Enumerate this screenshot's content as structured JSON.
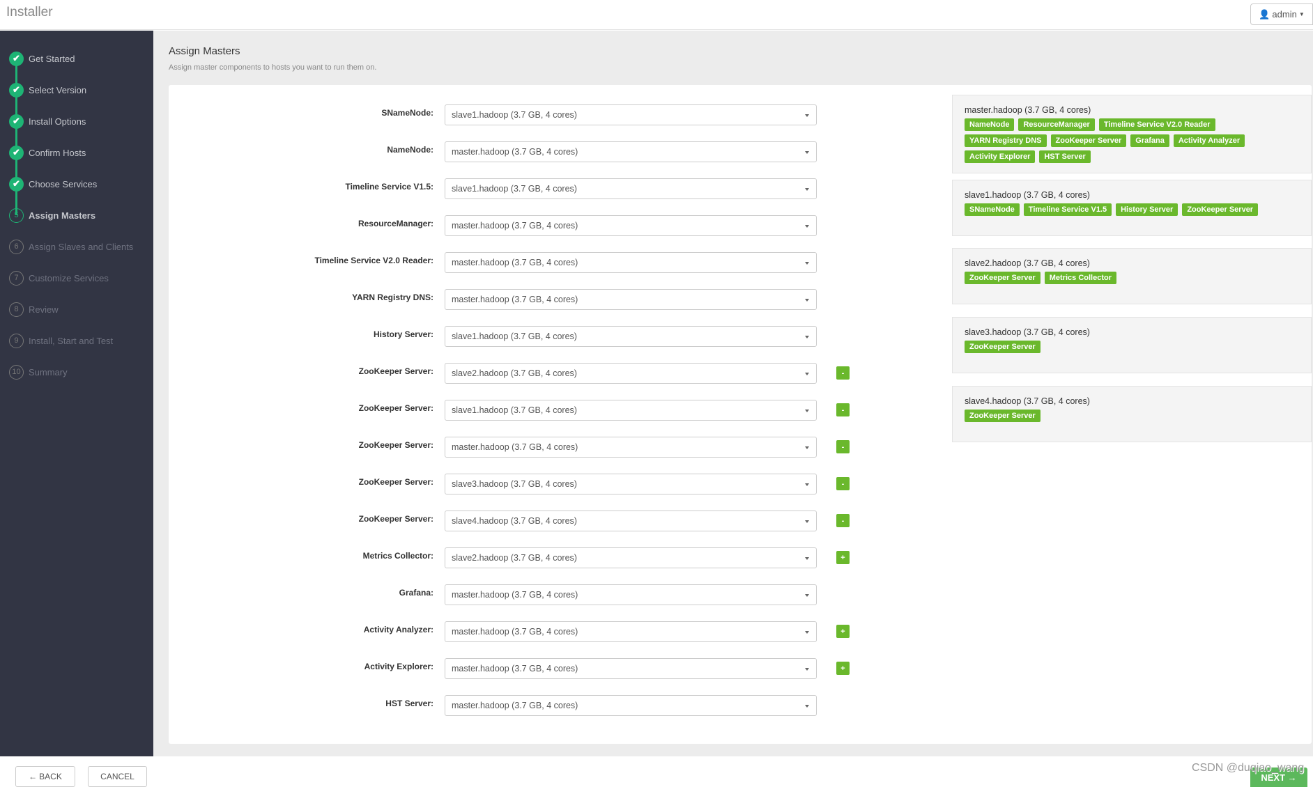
{
  "header": {
    "logo": "Installer",
    "user": "admin"
  },
  "sidebar": {
    "steps": [
      {
        "num": "1",
        "label": "Get Started",
        "state": "done"
      },
      {
        "num": "2",
        "label": "Select Version",
        "state": "done"
      },
      {
        "num": "3",
        "label": "Install Options",
        "state": "done"
      },
      {
        "num": "4",
        "label": "Confirm Hosts",
        "state": "done"
      },
      {
        "num": "5",
        "label": "Choose Services",
        "state": "done"
      },
      {
        "num": "5",
        "label": "Assign Masters",
        "state": "current"
      },
      {
        "num": "6",
        "label": "Assign Slaves and Clients",
        "state": "todo"
      },
      {
        "num": "7",
        "label": "Customize Services",
        "state": "todo"
      },
      {
        "num": "8",
        "label": "Review",
        "state": "todo"
      },
      {
        "num": "9",
        "label": "Install, Start and Test",
        "state": "todo"
      },
      {
        "num": "10",
        "label": "Summary",
        "state": "todo"
      }
    ]
  },
  "main": {
    "title": "Assign Masters",
    "subtitle": "Assign master components to hosts you want to run them on.",
    "rows": [
      {
        "label": "SNameNode:",
        "value": "slave1.hadoop (3.7 GB, 4 cores)",
        "action": ""
      },
      {
        "label": "NameNode:",
        "value": "master.hadoop (3.7 GB, 4 cores)",
        "action": ""
      },
      {
        "label": "Timeline Service V1.5:",
        "value": "slave1.hadoop (3.7 GB, 4 cores)",
        "action": ""
      },
      {
        "label": "ResourceManager:",
        "value": "master.hadoop (3.7 GB, 4 cores)",
        "action": ""
      },
      {
        "label": "Timeline Service V2.0 Reader:",
        "value": "master.hadoop (3.7 GB, 4 cores)",
        "action": ""
      },
      {
        "label": "YARN Registry DNS:",
        "value": "master.hadoop (3.7 GB, 4 cores)",
        "action": ""
      },
      {
        "label": "History Server:",
        "value": "slave1.hadoop (3.7 GB, 4 cores)",
        "action": ""
      },
      {
        "label": "ZooKeeper Server:",
        "value": "slave2.hadoop (3.7 GB, 4 cores)",
        "action": "-"
      },
      {
        "label": "ZooKeeper Server:",
        "value": "slave1.hadoop (3.7 GB, 4 cores)",
        "action": "-"
      },
      {
        "label": "ZooKeeper Server:",
        "value": "master.hadoop (3.7 GB, 4 cores)",
        "action": "-"
      },
      {
        "label": "ZooKeeper Server:",
        "value": "slave3.hadoop (3.7 GB, 4 cores)",
        "action": "-"
      },
      {
        "label": "ZooKeeper Server:",
        "value": "slave4.hadoop (3.7 GB, 4 cores)",
        "action": "-"
      },
      {
        "label": "Metrics Collector:",
        "value": "slave2.hadoop (3.7 GB, 4 cores)",
        "action": "+"
      },
      {
        "label": "Grafana:",
        "value": "master.hadoop (3.7 GB, 4 cores)",
        "action": ""
      },
      {
        "label": "Activity Analyzer:",
        "value": "master.hadoop (3.7 GB, 4 cores)",
        "action": "+"
      },
      {
        "label": "Activity Explorer:",
        "value": "master.hadoop (3.7 GB, 4 cores)",
        "action": "+"
      },
      {
        "label": "HST Server:",
        "value": "master.hadoop (3.7 GB, 4 cores)",
        "action": ""
      }
    ],
    "hosts": [
      {
        "name": "master.hadoop (3.7 GB, 4 cores)",
        "components": [
          "NameNode",
          "ResourceManager",
          "Timeline Service V2.0 Reader",
          "YARN Registry DNS",
          "ZooKeeper Server",
          "Grafana",
          "Activity Analyzer",
          "Activity Explorer",
          "HST Server"
        ]
      },
      {
        "name": "slave1.hadoop (3.7 GB, 4 cores)",
        "components": [
          "SNameNode",
          "Timeline Service V1.5",
          "History Server",
          "ZooKeeper Server"
        ]
      },
      {
        "name": "slave2.hadoop (3.7 GB, 4 cores)",
        "components": [
          "ZooKeeper Server",
          "Metrics Collector"
        ]
      },
      {
        "name": "slave3.hadoop (3.7 GB, 4 cores)",
        "components": [
          "ZooKeeper Server"
        ]
      },
      {
        "name": "slave4.hadoop (3.7 GB, 4 cores)",
        "components": [
          "ZooKeeper Server"
        ]
      }
    ]
  },
  "footer": {
    "back": "BACK",
    "cancel": "CANCEL",
    "next": "NEXT",
    "watermark": "CSDN @duqiao_wang"
  },
  "colors": {
    "accent": "#1eb475",
    "tag": "#6ab82c",
    "sidebar": "#323544"
  }
}
